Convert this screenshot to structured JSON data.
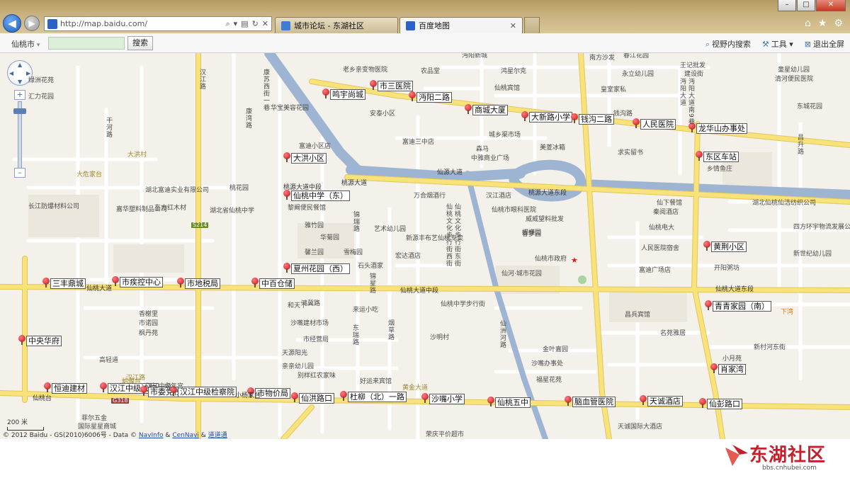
{
  "browser": {
    "address": "http://map.baidu.com/",
    "tabs": [
      {
        "label": "城市论坛 - 东湖社区"
      },
      {
        "label": "百度地图"
      }
    ]
  },
  "toolbar": {
    "city": "仙桃市",
    "search_value": "",
    "search_button": "搜索",
    "in_view_search": "视野内搜索",
    "tools": "工具",
    "exit_fullscreen": "退出全屏"
  },
  "map": {
    "scale": "200 米",
    "copyright_prefix": "© 2012 Baidu - GS(2010)6006号 - Data ©",
    "copyright_navinfo": "NavInfo",
    "copyright_amp": "&",
    "copyright_cennavi": "CenNavi",
    "copyright_amp2": "&",
    "copyright_daodaotong": "道道通",
    "colors": {
      "arterial": "#f8e27a",
      "minor": "#ffffff",
      "river": "#9db4d3",
      "pin": "#c4101b"
    },
    "markers": [
      {
        "label": "市三医院"
      },
      {
        "label": "鸣宇尚城"
      },
      {
        "label": "沔阳二路"
      },
      {
        "label": "商城大厦"
      },
      {
        "label": "大新路小学"
      },
      {
        "label": "钱沟二路"
      },
      {
        "label": "人民医院"
      },
      {
        "label": "龙华山办事处"
      },
      {
        "label": "大洪小区"
      },
      {
        "label": "东区车站"
      },
      {
        "label": "仙桃中学（东）"
      },
      {
        "label": "黄荆小区"
      },
      {
        "label": "夏州花园（西）"
      },
      {
        "label": "三丰鼎城"
      },
      {
        "label": "市疾控中心"
      },
      {
        "label": "市地税局"
      },
      {
        "label": "中百仓储"
      },
      {
        "label": "青青家园（南）"
      },
      {
        "label": "中央华府"
      },
      {
        "label": "肖家湾"
      },
      {
        "label": "恒迪建材"
      },
      {
        "label": "汉江中级法院"
      },
      {
        "label": "市委党校"
      },
      {
        "label": "汉江中级检察院"
      },
      {
        "label": "市物价局"
      },
      {
        "label": "仙洪路口"
      },
      {
        "label": "杜柳（北）一路"
      },
      {
        "label": "沙嘴小学"
      },
      {
        "label": "仙桃五中"
      },
      {
        "label": "脑血管医院"
      },
      {
        "label": "天诚酒店"
      },
      {
        "label": "仙彭路口"
      }
    ],
    "labels": [
      "老乡亲变物医院",
      "沔阳新城",
      "农品堂",
      "鸿星尔克",
      "南方沙发",
      "春江花园",
      "王记批发",
      "建设街",
      "绿洲花苑",
      "汇力花园",
      "康苏西街一巷",
      "华宝美容花园",
      "安泰小区",
      "仙桃宾馆",
      "永立幼儿园",
      "皇室家私",
      "钱沟路",
      "童星幼儿园",
      "清河便民医院",
      "东城花园",
      "汉江路",
      "干河路",
      "大洪村",
      "大危家台",
      "富迪小区店",
      "富迪三中店",
      "城乡渠市场",
      "森马",
      "中雅商业广场",
      "美菱冰箱",
      "求实留书",
      "乡情鱼庄",
      "昌升路",
      "仙源大道",
      "桃源大道",
      "桃源大道中段",
      "桃源大道东段",
      "汉江酒店",
      "万合烟酒行",
      "仙桃市眼科医院",
      "威威望料批发",
      "春梦园",
      "仙下餐馆",
      "秦阅酒店",
      "仙桃电大",
      "人民医院宿舍",
      "新世纪幼儿园",
      "四方环宇物流发展公司",
      "湖北富迪实业有限公司",
      "桃花园",
      "东方红木材",
      "湖北省仙桃中学",
      "黎阚便民餐馆",
      "长江防爆材料公司",
      "嘉华塑料制品公司",
      "锦瑞路",
      "雅竹园",
      "华菊园",
      "馨兰园",
      "雪梅园",
      "艺术幼儿园",
      "新源丰布艺仙桃专卖",
      "宏达酒店",
      "石头酒家",
      "仙桃市政府",
      "仙河·城市花园",
      "富迪广场店",
      "开阳粥坊",
      "蝶蝶园",
      "锦星路",
      "仙桃大道",
      "仙桃大道中段",
      "仙桃大道东段",
      "鸿冀路",
      "香榭里",
      "市诺园",
      "枫丹苑",
      "和天下",
      "来运小吃",
      "仙桃中学步行街",
      "沙嘴建材市场",
      "沙明村",
      "市经营局",
      "东瑞路",
      "烟草路",
      "昌兵宾馆",
      "名苑雅居",
      "下湾",
      "新村河东街",
      "小月苑",
      "天源阳光",
      "亲亲幼儿园",
      "别样红农家味",
      "好运来宾馆",
      "金叶嘉园",
      "沙嘴办事处",
      "福星花苑",
      "高轻道",
      "汉江路",
      "仙桃台",
      "黄金大道",
      "小杨家台",
      "菲尔五金",
      "国际星星商城",
      "荣庆平价超市",
      "天诚国际大酒店",
      "仙洲河路",
      "仙桃文化步行街东街",
      "仙桃文化步行街西街",
      "康湾路",
      "湖北仙桃仙洁纺织公司",
      "沔阳大道",
      "沔阳大道南9巷",
      "S214",
      "G318",
      "蛤蟆台",
      "汉江中级",
      "少年宫"
    ]
  },
  "watermark": {
    "brand": "东湖社区",
    "site": "bbs.cnhubei.com"
  }
}
